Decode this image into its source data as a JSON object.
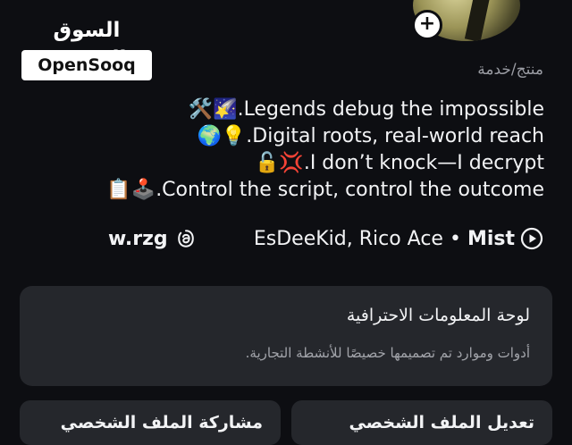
{
  "logo": {
    "arabic": "السوق المفتوح",
    "english": "OpenSooq"
  },
  "profile": {
    "category": "منتج/خدمة",
    "bio": [
      {
        "text": ".Legends debug the impossible",
        "emoji": "🛠️🌠"
      },
      {
        "text": ".Digital roots, real-world reach",
        "emoji": "🌍💡"
      },
      {
        "text": ".I don’t knock—I decrypt",
        "emoji": "🔓💢"
      },
      {
        "text": ".Control the script, control the outcome",
        "emoji": "📋🕹️"
      }
    ],
    "threads_handle": "w.rzg",
    "music": {
      "artists": "EsDeeKid, Rico Ace",
      "separator": "•",
      "track": "Mist"
    }
  },
  "professional_dashboard": {
    "title": "لوحة المعلومات الاحترافية",
    "subtitle": "أدوات وموارد تم تصميمها خصيصًا للأنشطة التجارية."
  },
  "actions": {
    "edit_profile": "تعديل الملف الشخصي",
    "share_profile": "مشاركة الملف الشخصي"
  }
}
